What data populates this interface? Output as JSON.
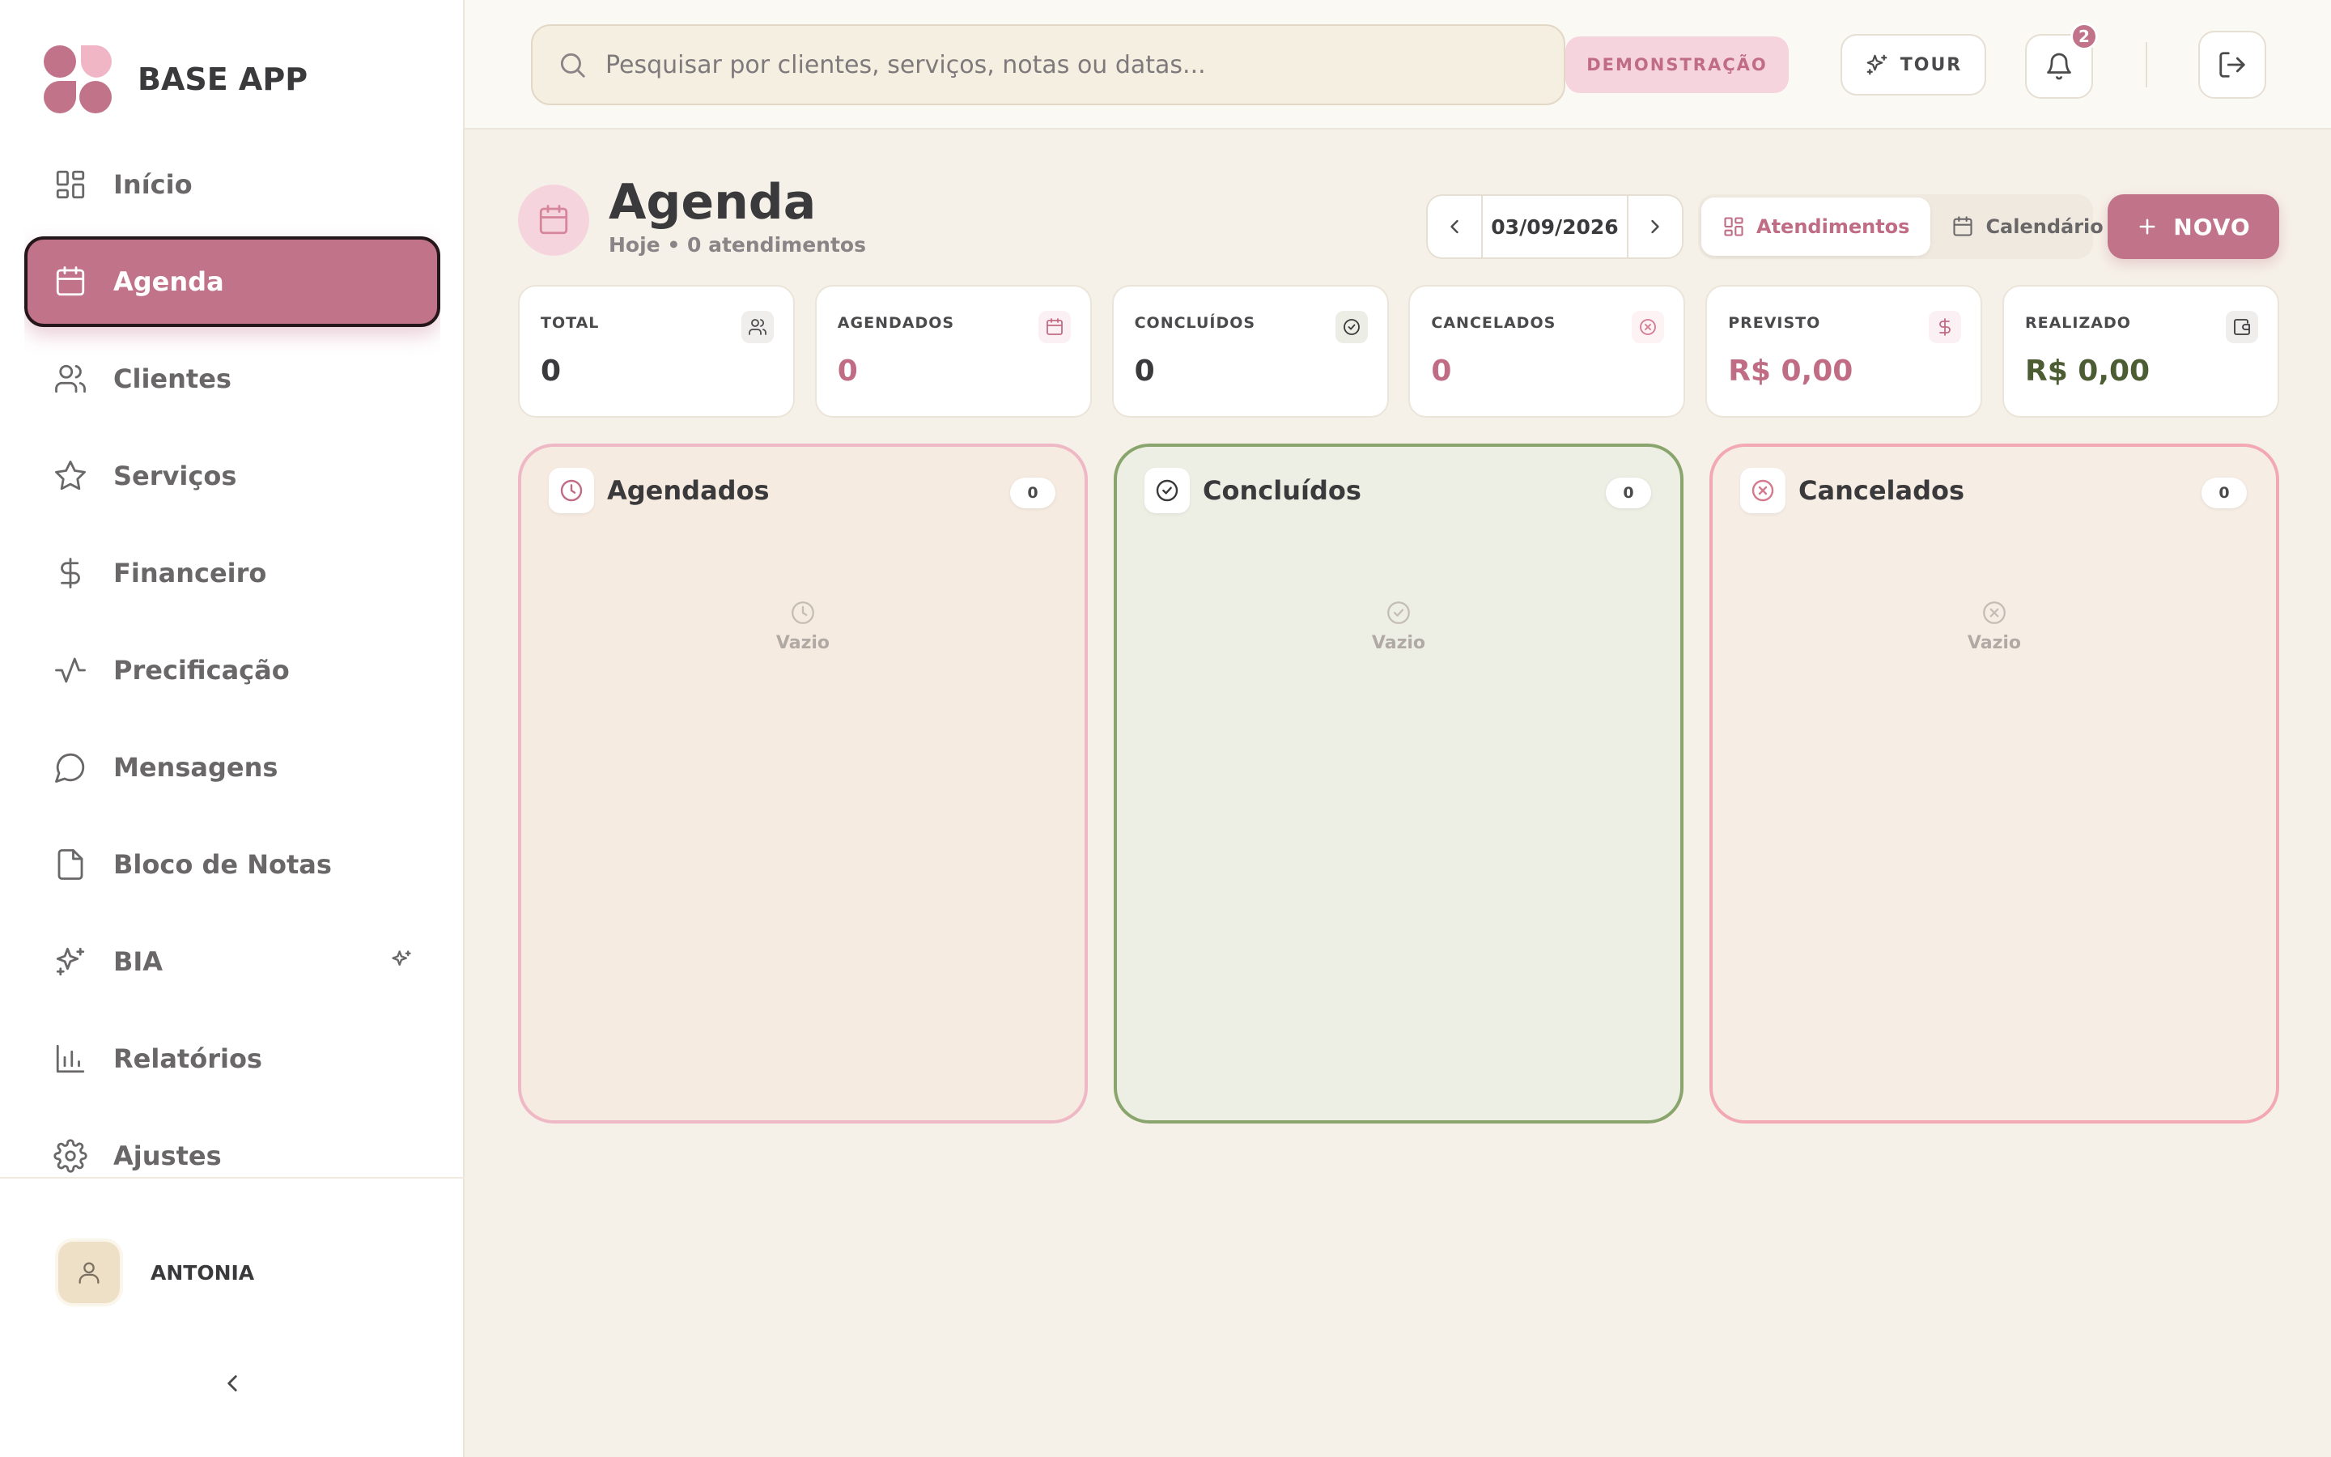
{
  "brand": {
    "name": "BASE APP",
    "logo_color": "#c17389"
  },
  "sidebar": {
    "items": [
      {
        "label": "Início",
        "icon": "grid-icon"
      },
      {
        "label": "Agenda",
        "icon": "calendar-icon",
        "active": true
      },
      {
        "label": "Clientes",
        "icon": "users-icon"
      },
      {
        "label": "Serviços",
        "icon": "star-icon"
      },
      {
        "label": "Financeiro",
        "icon": "dollar-icon"
      },
      {
        "label": "Precificação",
        "icon": "activity-icon"
      },
      {
        "label": "Mensagens",
        "icon": "message-icon"
      },
      {
        "label": "Bloco de Notas",
        "icon": "file-icon"
      },
      {
        "label": "BIA",
        "icon": "sparkles-icon"
      },
      {
        "label": "Relatórios",
        "icon": "bar-chart-icon"
      },
      {
        "label": "Ajustes",
        "icon": "gear-icon"
      }
    ],
    "user": {
      "name": "ANTONIA"
    }
  },
  "topbar": {
    "search_placeholder": "Pesquisar por clientes, serviços, notas ou datas...",
    "demo_label": "DEMONSTRAÇÃO",
    "tour_label": "TOUR",
    "notifications_count": "2"
  },
  "header": {
    "title": "Agenda",
    "subtitle": "Hoje • 0 atendimentos",
    "date": "03/09/2026",
    "view_atendimentos": "Atendimentos",
    "view_calendario": "Calendário",
    "new_label": "NOVO"
  },
  "stats": [
    {
      "label": "TOTAL",
      "value": "0",
      "color": "#3a393b"
    },
    {
      "label": "AGENDADOS",
      "value": "0",
      "color": "#c06c85"
    },
    {
      "label": "CONCLUÍDOS",
      "value": "0",
      "color": "#3a393b"
    },
    {
      "label": "CANCELADOS",
      "value": "0",
      "color": "#c06c85"
    },
    {
      "label": "PREVISTO",
      "value": "R$ 0,00",
      "color": "#c06c85"
    },
    {
      "label": "REALIZADO",
      "value": "R$ 0,00",
      "color": "#4c5d33"
    }
  ],
  "columns": [
    {
      "title": "Agendados",
      "count": "0",
      "empty": "Vazio",
      "bg": "#f6ebe0",
      "border": "#efb8c6"
    },
    {
      "title": "Concluídos",
      "count": "0",
      "empty": "Vazio",
      "bg": "#edeee4",
      "border": "#8aa46d"
    },
    {
      "title": "Cancelados",
      "count": "0",
      "empty": "Vazio",
      "bg": "#f6ede4",
      "border": "#f2a9b3"
    }
  ]
}
